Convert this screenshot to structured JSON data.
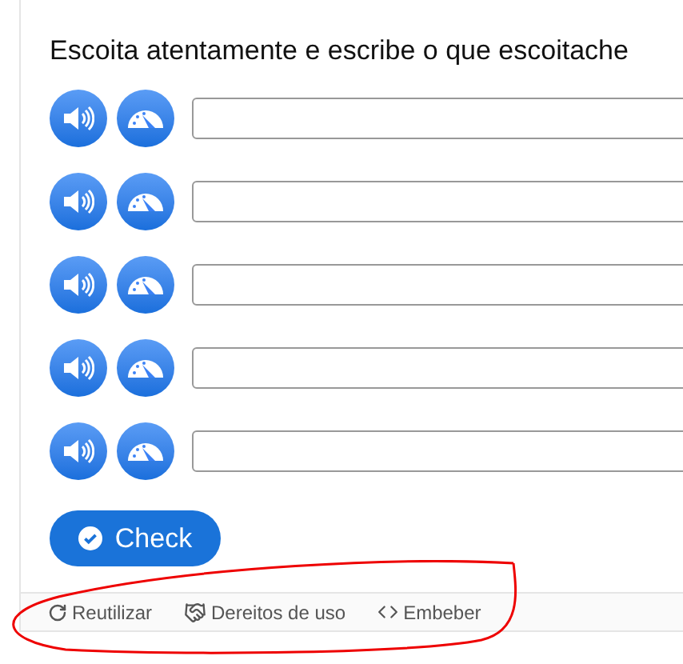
{
  "title": "Escoita atentamente e escribe o que escoitache",
  "items": [
    {
      "value": ""
    },
    {
      "value": ""
    },
    {
      "value": ""
    },
    {
      "value": ""
    },
    {
      "value": ""
    }
  ],
  "check_button": "Check",
  "footer": [
    {
      "kind": "reuse",
      "label": "Reutilizar"
    },
    {
      "kind": "rights",
      "label": "Dereitos de uso"
    },
    {
      "kind": "embed",
      "label": "Embeber"
    }
  ]
}
